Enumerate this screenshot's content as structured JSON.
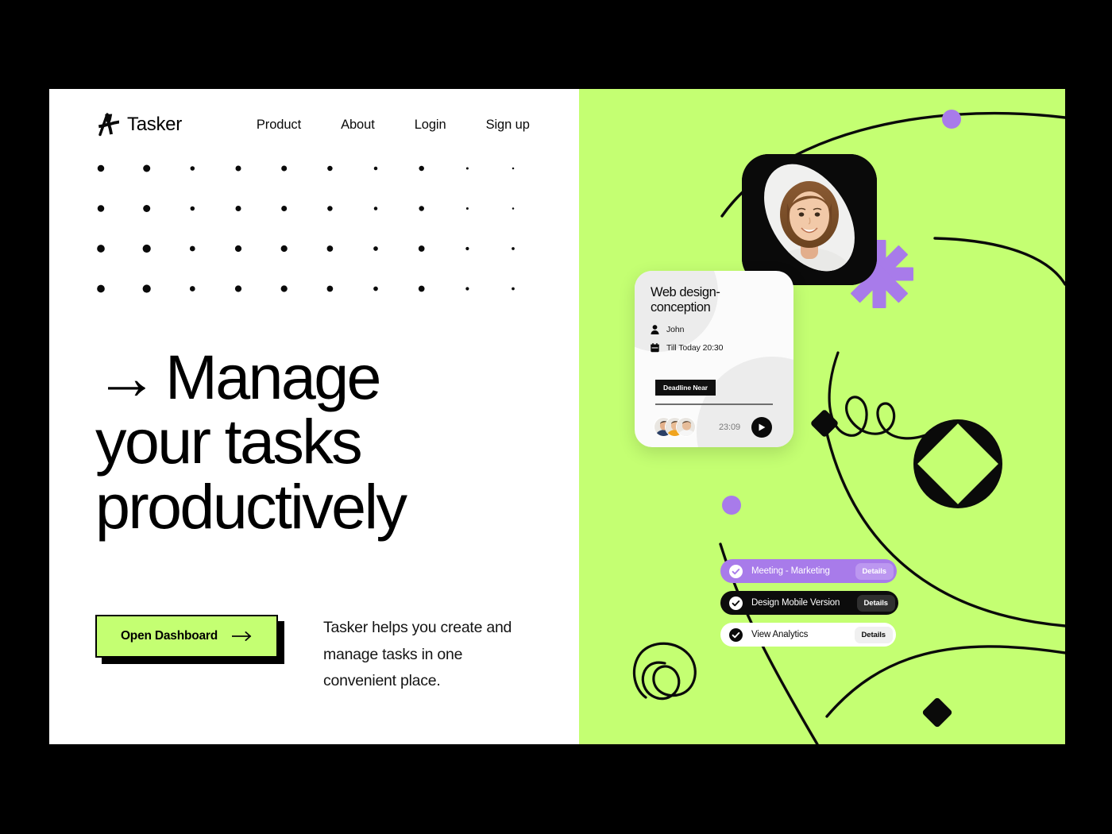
{
  "theme": {
    "green": "#C4FF72",
    "purple": "#A87BEA",
    "black": "#000000",
    "white": "#FFFFFF"
  },
  "brand": {
    "name": "Tasker",
    "mark": "sparkle-icon"
  },
  "nav": {
    "links": [
      {
        "label": "Product"
      },
      {
        "label": "About"
      },
      {
        "label": "Login"
      },
      {
        "label": "Sign up"
      }
    ]
  },
  "hero": {
    "arrow": "→",
    "heading_line_1": "Manage",
    "heading_line_2": "your tasks",
    "heading_line_3": "productively",
    "cta_label": "Open Dashboard",
    "cta_icon": "arrow-right-icon",
    "tagline": "Tasker helps you create and manage tasks in one convenient place."
  },
  "decor": {
    "dot_grid": {
      "rows": 4,
      "cols": 10,
      "col_sizes": [
        8.5,
        9,
        5.5,
        7,
        7,
        6.5,
        4.5,
        6.5,
        3,
        2.5
      ],
      "row_bonus": [
        0,
        0,
        1.2,
        1.2
      ]
    },
    "asterisk": "asterisk-icon",
    "squiggle": "squiggle-icon",
    "spiral": "spiral-icon",
    "diamond_circle": "diamond-circle-icon",
    "dots": [
      "purple-orbit-dot",
      "purple-orbit-dot",
      "black-diamond-node",
      "black-diamond-node"
    ]
  },
  "photo_card": {
    "alt": "portrait-photo",
    "label": "team-member-portrait"
  },
  "task_card": {
    "title": "Web design-\nconception",
    "title_line_1": "Web design-",
    "title_line_2": "conception",
    "assignee_icon": "person-icon",
    "assignee": "John",
    "date_icon": "calendar-icon",
    "due": "Till Today 20:30",
    "badge": "Deadline Near",
    "time": "23:09",
    "play_icon": "play-icon",
    "avatars": [
      {
        "name": "avatar-1",
        "shirt": "#2a3f66",
        "skin": "#e3b08a",
        "hair": "#2b2118"
      },
      {
        "name": "avatar-2",
        "shirt": "#f0a41e",
        "skin": "#e8bb93",
        "hair": "#3a2a18"
      },
      {
        "name": "avatar-3",
        "shirt": "#f2f2f2",
        "skin": "#e6bc99",
        "hair": "#4a3624"
      }
    ]
  },
  "task_list": {
    "details_label": "Details",
    "check_icon": "check-circle-icon",
    "items": [
      {
        "label": "Meeting - Marketing",
        "style": "purple"
      },
      {
        "label": "Design Mobile Version",
        "style": "black"
      },
      {
        "label": "View Analytics",
        "style": "white"
      }
    ]
  }
}
